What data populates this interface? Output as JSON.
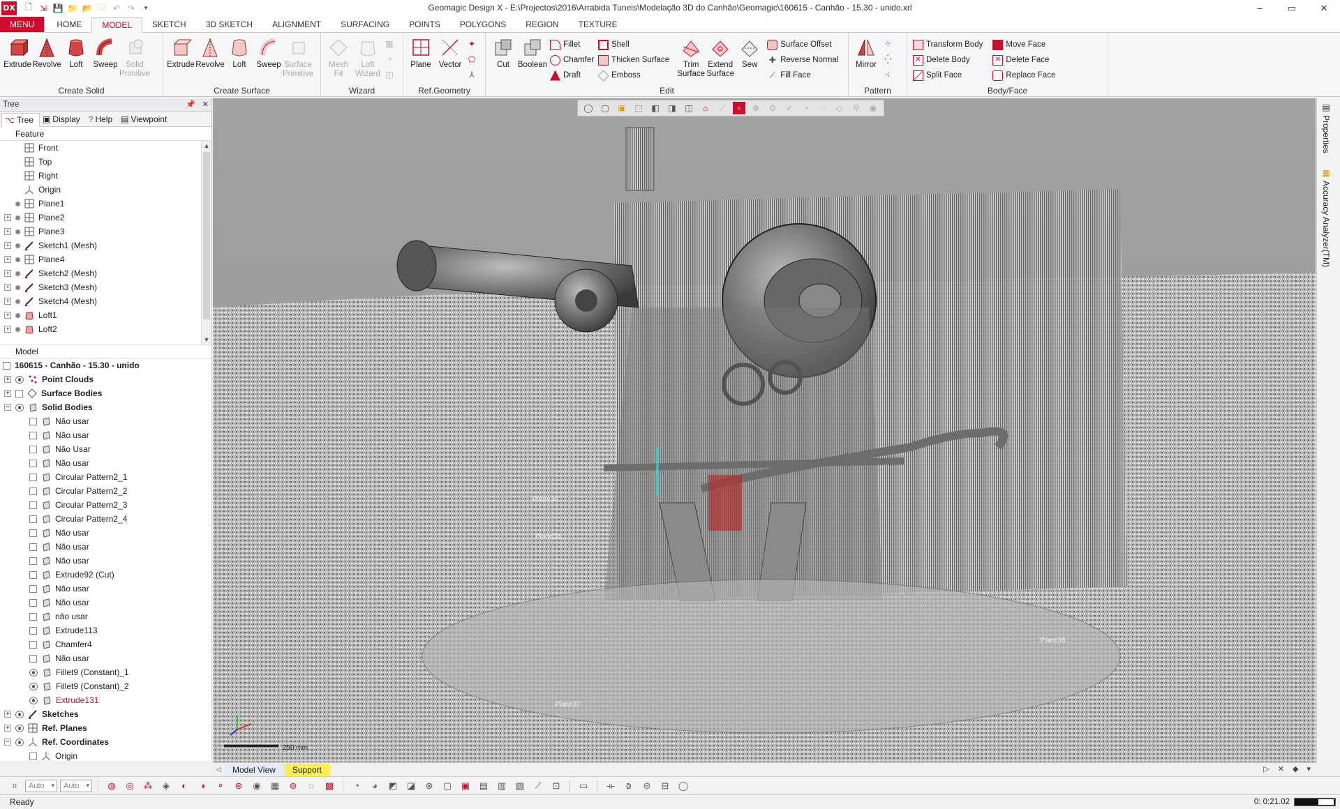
{
  "app": {
    "logo": "DX",
    "title": "Geomagic Design X - E:\\Projectos\\2016\\Arrabida Tuneis\\Modelação 3D do Canhão\\Geomagic\\160615 - Canhão - 15.30 - unido.xrl"
  },
  "window_controls": {
    "minimize": "–",
    "restore": "▭",
    "close": "✕"
  },
  "ribbon_tabs": [
    "MENU",
    "HOME",
    "MODEL",
    "SKETCH",
    "3D SKETCH",
    "ALIGNMENT",
    "SURFACING",
    "POINTS",
    "POLYGONS",
    "REGION",
    "TEXTURE"
  ],
  "ribbon": {
    "create_solid": {
      "label": "Create Solid",
      "buttons": [
        "Extrude",
        "Revolve",
        "Loft",
        "Sweep",
        "Solid\nPrimitive"
      ]
    },
    "create_surface": {
      "label": "Create Surface",
      "buttons": [
        "Extrude",
        "Revolve",
        "Loft",
        "Sweep",
        "Surface\nPrimitive"
      ]
    },
    "wizard": {
      "label": "Wizard",
      "buttons": [
        "Mesh\nFit",
        "Loft\nWizard"
      ]
    },
    "ref_geometry": {
      "label": "Ref.Geometry",
      "buttons": [
        "Plane",
        "Vector"
      ]
    },
    "edit": {
      "label": "Edit",
      "big": [
        "Cut",
        "Boolean"
      ],
      "col1": [
        "Fillet",
        "Chamfer",
        "Draft"
      ],
      "col2": [
        "Shell",
        "Thicken Surface",
        "Emboss"
      ],
      "big2": [
        "Trim\nSurface",
        "Extend\nSurface",
        "Sew"
      ],
      "col3": [
        "Surface Offset",
        "Reverse Normal",
        "Fill Face"
      ]
    },
    "pattern": {
      "label": "Pattern",
      "buttons": [
        "Mirror"
      ]
    },
    "body_face": {
      "label": "Body/Face",
      "col1": [
        "Transform Body",
        "Delete Body",
        "Split Face"
      ],
      "col2": [
        "Move Face",
        "Delete Face",
        "Replace Face"
      ]
    }
  },
  "left_panel": {
    "title": "Tree",
    "tabs": [
      "Tree",
      "Display",
      "Help",
      "Viewpoint"
    ],
    "feature_header": "Feature",
    "feature_items": [
      {
        "label": "Front",
        "expander": false,
        "dot": false,
        "icon": "plane"
      },
      {
        "label": "Top",
        "expander": false,
        "dot": false,
        "icon": "plane"
      },
      {
        "label": "Right",
        "expander": false,
        "dot": false,
        "icon": "plane"
      },
      {
        "label": "Origin",
        "expander": false,
        "dot": false,
        "icon": "origin"
      },
      {
        "label": "Plane1",
        "expander": false,
        "dot": true,
        "icon": "plane"
      },
      {
        "label": "Plane2",
        "expander": true,
        "dot": true,
        "icon": "plane"
      },
      {
        "label": "Plane3",
        "expander": true,
        "dot": true,
        "icon": "plane"
      },
      {
        "label": "Sketch1 (Mesh)",
        "expander": true,
        "dot": true,
        "icon": "sketch"
      },
      {
        "label": "Plane4",
        "expander": true,
        "dot": true,
        "icon": "plane"
      },
      {
        "label": "Sketch2 (Mesh)",
        "expander": true,
        "dot": true,
        "icon": "sketch"
      },
      {
        "label": "Sketch3 (Mesh)",
        "expander": true,
        "dot": true,
        "icon": "sketch"
      },
      {
        "label": "Sketch4 (Mesh)",
        "expander": true,
        "dot": true,
        "icon": "sketch"
      },
      {
        "label": "Loft1",
        "expander": true,
        "dot": true,
        "icon": "loft"
      },
      {
        "label": "Loft2",
        "expander": true,
        "dot": true,
        "icon": "loft"
      }
    ],
    "model_header": "Model",
    "model_root": "160615 - Canhão - 15.30 - unido",
    "model_groups": [
      {
        "label": "Point Clouds",
        "expander": "+",
        "icon": "points"
      },
      {
        "label": "Surface Bodies",
        "expander": "+",
        "icon": "surface"
      },
      {
        "label": "Solid Bodies",
        "expander": "−",
        "icon": "solid"
      }
    ],
    "solid_bodies": [
      {
        "label": "Não usar",
        "eye": false,
        "red": false
      },
      {
        "label": "Não usar",
        "eye": false,
        "red": false
      },
      {
        "label": "Não Usar",
        "eye": false,
        "red": false
      },
      {
        "label": "Não usar",
        "eye": false,
        "red": false
      },
      {
        "label": "Circular Pattern2_1",
        "eye": false,
        "red": false
      },
      {
        "label": "Circular Pattern2_2",
        "eye": false,
        "red": false
      },
      {
        "label": "Circular Pattern2_3",
        "eye": false,
        "red": false
      },
      {
        "label": "Circular Pattern2_4",
        "eye": false,
        "red": false
      },
      {
        "label": "Não usar",
        "eye": false,
        "red": false
      },
      {
        "label": "Não usar",
        "eye": false,
        "red": false
      },
      {
        "label": "Não usar",
        "eye": false,
        "red": false
      },
      {
        "label": "Extrude92 (Cut)",
        "eye": false,
        "red": false
      },
      {
        "label": "Não usar",
        "eye": false,
        "red": false
      },
      {
        "label": "Não usar",
        "eye": false,
        "red": false
      },
      {
        "label": "não usar",
        "eye": false,
        "red": false
      },
      {
        "label": "Extrude113",
        "eye": false,
        "red": false
      },
      {
        "label": "Chamfer4",
        "eye": false,
        "red": false
      },
      {
        "label": "Não usar",
        "eye": false,
        "red": false
      },
      {
        "label": "Fillet9 (Constant)_1",
        "eye": true,
        "red": false
      },
      {
        "label": "Fillet9 (Constant)_2",
        "eye": true,
        "red": false
      },
      {
        "label": "Extrude131",
        "eye": true,
        "red": true
      }
    ],
    "model_groups_2": [
      {
        "label": "Sketches",
        "expander": "+",
        "icon": "sketch"
      },
      {
        "label": "Ref. Planes",
        "expander": "+",
        "icon": "plane"
      },
      {
        "label": "Ref. Coordinates",
        "expander": "−",
        "icon": "origin"
      }
    ],
    "ref_coord_child": "Origin"
  },
  "viewport": {
    "plane_labels": [
      "Plane30",
      "Plane34",
      "Plane36",
      "Plane37"
    ],
    "scale_label": "250 mm"
  },
  "right_dock": {
    "tabs": [
      "Properties",
      "Accuracy Analyzer(TM)"
    ]
  },
  "bottom_tabs": [
    "Model View",
    "Support"
  ],
  "bottom_toolbar": {
    "select1": "Auto",
    "select2": "Auto"
  },
  "status": {
    "text": "Ready",
    "time": "0: 0:21.02"
  }
}
